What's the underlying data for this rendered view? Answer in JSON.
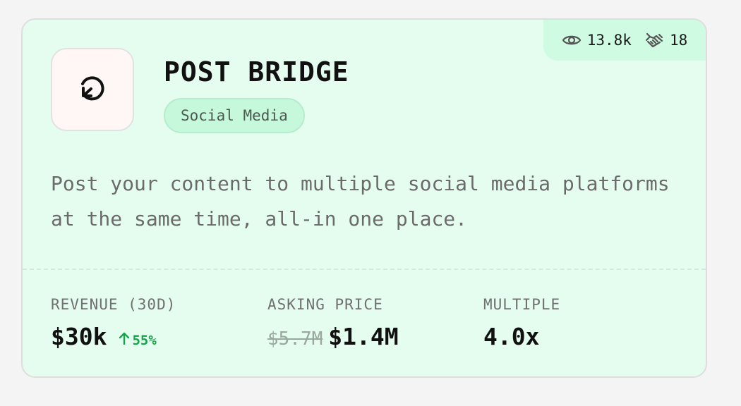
{
  "listing": {
    "name": "POST BRIDGE",
    "category": "Social Media",
    "description": "Post your content to multiple social media platforms at the same time, all-in one place.",
    "logo_icon": "rotate-ccw-arrow-icon",
    "stats": {
      "views": "13.8k",
      "views_icon": "eye-icon",
      "offers": "18",
      "offers_icon": "handshake-icon"
    },
    "metrics": {
      "revenue_label": "REVENUE (30D)",
      "revenue_value": "$30k",
      "revenue_growth": "55%",
      "asking_label": "ASKING PRICE",
      "asking_old": "$5.7M",
      "asking_value": "$1.4M",
      "multiple_label": "MULTIPLE",
      "multiple_value": "4.0x"
    },
    "colors": {
      "card_bg": "#e5fdef",
      "chip_bg": "#cffbe2",
      "badge_bg": "#c6f8dc",
      "growth": "#16a34a"
    }
  }
}
